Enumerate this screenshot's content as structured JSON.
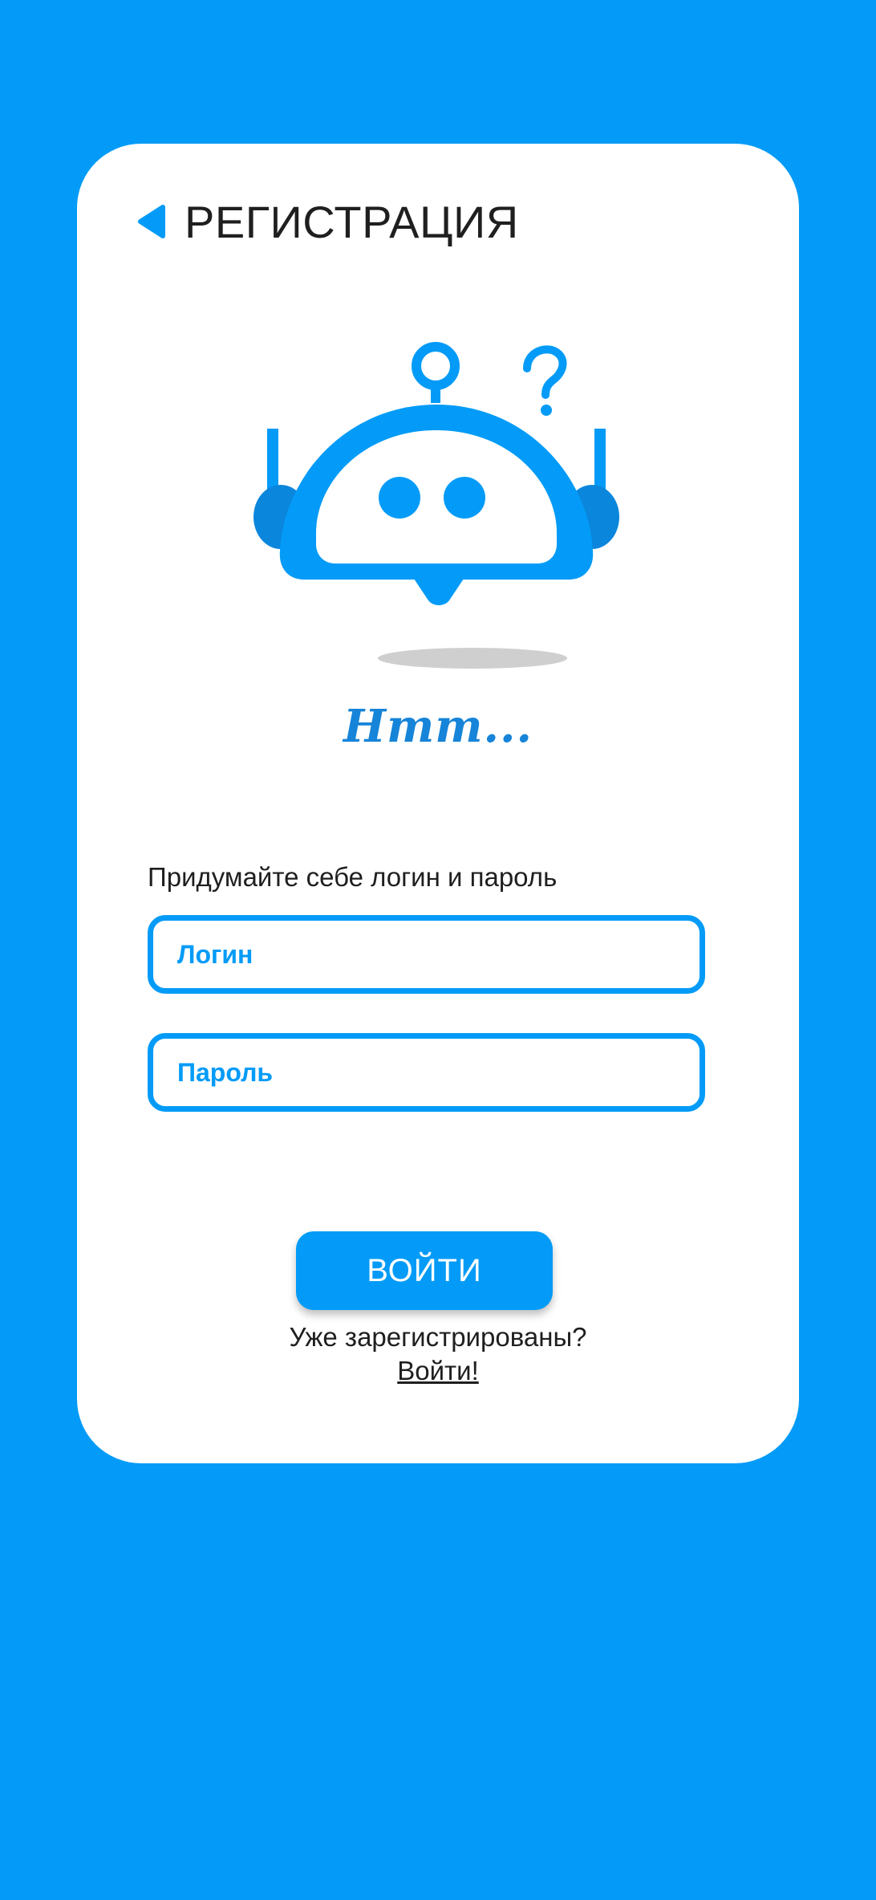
{
  "header": {
    "back_icon": "back-triangle-icon",
    "title": "РЕГИСТРАЦИЯ"
  },
  "illustration": {
    "icon": "robot-question-icon",
    "caption": "Hmm..."
  },
  "form": {
    "prompt": "Придумайте себе логин и пароль",
    "login_placeholder": "Логин",
    "password_placeholder": "Пароль",
    "submit_label": "ВОЙТИ"
  },
  "footer": {
    "already_text": "Уже зарегистрированы?",
    "login_link": "Войти!"
  },
  "colors": {
    "background": "#039BF7",
    "accent": "#039BF7",
    "caption": "#1684D8",
    "card": "#FFFFFF",
    "text": "#1F1F1F"
  }
}
